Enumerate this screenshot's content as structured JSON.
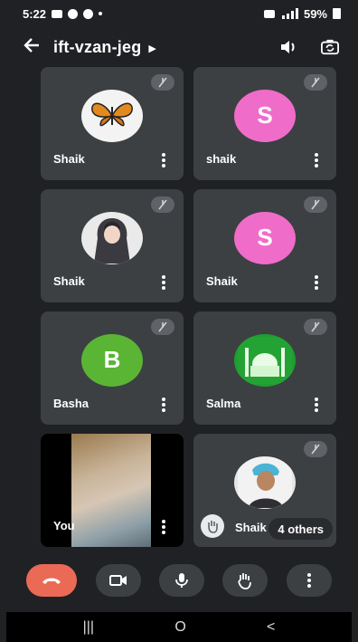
{
  "status_bar": {
    "time": "5:22",
    "battery": "59%"
  },
  "header": {
    "title": "ift-vzan-jeg",
    "back_icon": "arrow-left-icon",
    "speaker_icon": "speaker-icon",
    "camera_switch_icon": "switch-camera-icon"
  },
  "tiles": [
    {
      "name": "Shaik",
      "avatar": "butterfly-image",
      "muted": true
    },
    {
      "name": "shaik",
      "avatar_letter": "S",
      "avatar_color": "#f06cc9",
      "muted": true
    },
    {
      "name": "Shaik",
      "avatar": "anime-image",
      "muted": true
    },
    {
      "name": "Shaik",
      "avatar_letter": "S",
      "avatar_color": "#f06cc9",
      "muted": true
    },
    {
      "name": "Basha",
      "avatar_letter": "B",
      "avatar_color": "#5ab535",
      "muted": true
    },
    {
      "name": "Salma",
      "avatar": "mosque-image",
      "muted": true
    },
    {
      "name": "You",
      "video": true
    },
    {
      "name": "Shaik",
      "avatar": "person-image",
      "others": "4 others",
      "hand_raised": true
    }
  ],
  "controls": [
    {
      "icon": "end-call-icon",
      "color": "#ea6a55"
    },
    {
      "icon": "video-icon"
    },
    {
      "icon": "mic-icon"
    },
    {
      "icon": "raise-hand-icon"
    },
    {
      "icon": "more-options-icon"
    }
  ],
  "navbar": {
    "recents": "|||",
    "home": "O",
    "back": "<"
  }
}
